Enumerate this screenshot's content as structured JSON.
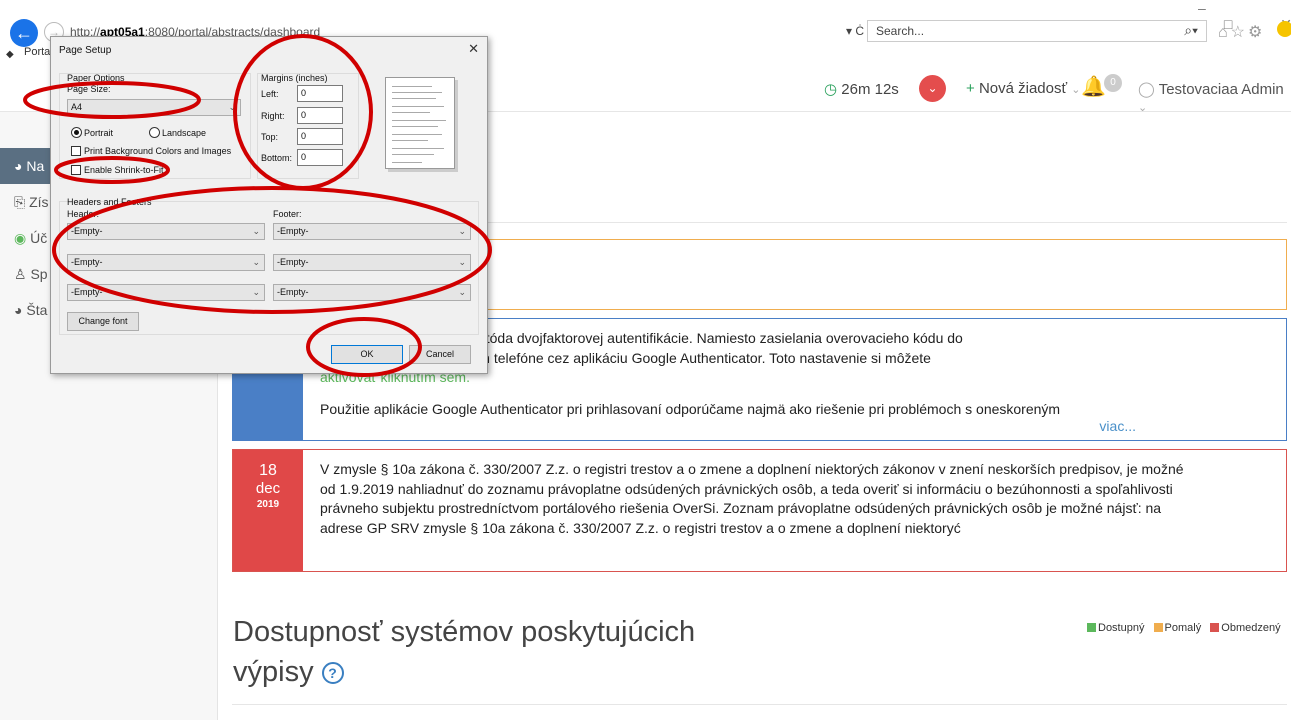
{
  "browser": {
    "url_prefix": "http://",
    "url_host": "apt05a1",
    "url_rest": ":8080/portal/abstracts/dashboard",
    "tab_label": "Porta",
    "search_placeholder": "Search...",
    "addr_controls": "▾ Ċ"
  },
  "header": {
    "timer": "26m 12s",
    "new_request": "Nová žiadosť",
    "bell_count": "0",
    "user": "Testovaciaa Admin"
  },
  "sidebar": {
    "items": [
      {
        "label": "Na",
        "icon": "dashboard-icon"
      },
      {
        "label": "Zís",
        "icon": "documents-icon"
      },
      {
        "label": "Úč",
        "icon": "account-icon"
      },
      {
        "label": "Sp",
        "icon": "users-icon"
      },
      {
        "label": "Šta",
        "icon": "statistics-icon"
      }
    ]
  },
  "news": [
    {
      "day": "",
      "month": "",
      "year": "",
      "p1_pre": "u OverSi pribudla nová metóda dvojfaktorovej autentifikácie. Namiesto zasielania overovacieho kódu do",
      "p1_line2": "erovať vo Vašom mobilnom telefóne cez aplikáciu Google Authenticator. Toto nastavenie si môžete",
      "p1_link": "aktivovať kliknutím sem.",
      "p2": "Použitie aplikácie Google Authenticator pri prihlasovaní odporúčame najmä ako riešenie pri problémoch s oneskoreným",
      "more": "viac..."
    },
    {
      "day": "18",
      "month": "dec",
      "year": "2019",
      "text": "V zmysle § 10a zákona č. 330/2007 Z.z. o registri trestov a o zmene a doplnení niektorých zákonov v znení neskorších predpisov, je možné od 1.9.2019 nahliadnuť do zoznamu právoplatne odsúdených právnických osôb, a teda overiť si informáciu o bezúhonnosti a spoľahlivosti právneho subjektu prostredníctvom portálového riešenia OverSi. Zoznam právoplatne odsúdených právnických osôb je možné nájsť: na adrese GP SRV zmysle § 10a zákona č. 330/2007 Z.z. o registri trestov a o zmene a doplnení niektoryć"
    }
  ],
  "availability": {
    "title": "Dostupnosť systémov poskytujúcich výpisy",
    "help": "?",
    "legend": [
      {
        "label": "Dostupný",
        "color": "#5cb85c"
      },
      {
        "label": "Pomalý",
        "color": "#f0ad4e"
      },
      {
        "label": "Obmedzený",
        "color": "#d9534f"
      }
    ]
  },
  "dialog": {
    "title": "Page Setup",
    "paper_options": "Paper Options",
    "page_size_label": "Page Size:",
    "page_size_value": "A4",
    "portrait": "Portrait",
    "landscape": "Landscape",
    "print_bg": "Print Background Colors and Images",
    "shrink": "Enable Shrink-to-Fit",
    "margins_label": "Margins (inches)",
    "left_label": "Left:",
    "right_label": "Right:",
    "top_label": "Top:",
    "bottom_label": "Bottom:",
    "left_value": "0",
    "right_value": "0",
    "top_value": "0",
    "bottom_value": "0",
    "hf_label": "Headers and Footers",
    "header_label": "Header:",
    "footer_label": "Footer:",
    "header_values": [
      "-Empty-",
      "-Empty-",
      "-Empty-"
    ],
    "footer_values": [
      "-Empty-",
      "-Empty-",
      "-Empty-"
    ],
    "change_font": "Change font",
    "ok": "OK",
    "cancel": "Cancel"
  },
  "colors": {
    "annotation": "#d00000",
    "blue_news": "#4a7fc6",
    "red_news": "#d9534f"
  }
}
